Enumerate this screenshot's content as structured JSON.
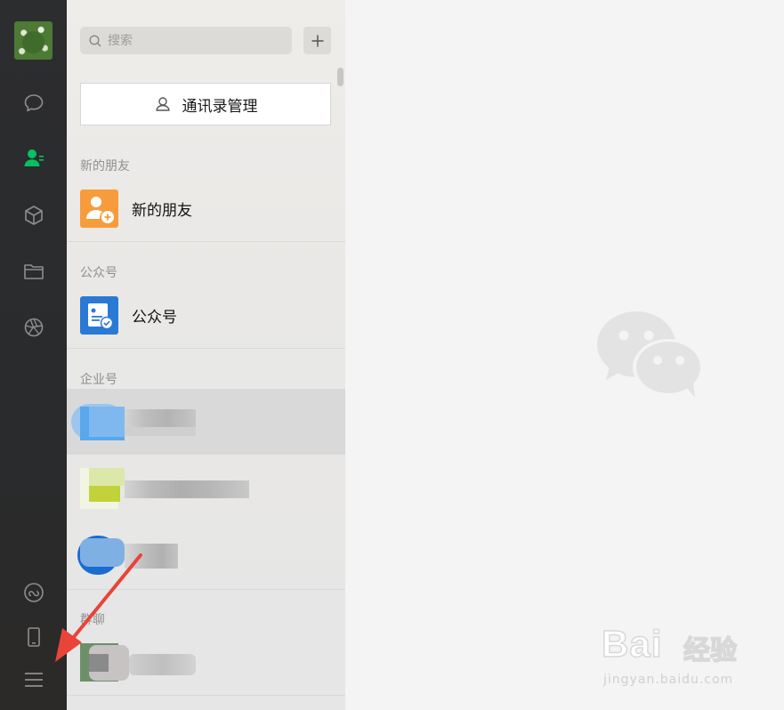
{
  "sidebar": {
    "avatar": "user-avatar",
    "icons": [
      "chat-icon",
      "contacts-icon",
      "favorites-cube-icon",
      "files-folder-icon",
      "moments-icon",
      "mini-program-icon",
      "phone-icon",
      "menu-icon"
    ],
    "active": "contacts-icon",
    "accent": "#07c160"
  },
  "search": {
    "placeholder": "搜索"
  },
  "add_button": "+",
  "manage_contacts": {
    "label": "通讯录管理"
  },
  "sections": {
    "new_friends": "新的朋友",
    "official_accounts": "公众号",
    "enterprise": "企业号",
    "group_chats": "群聊"
  },
  "rows": {
    "new_friends": "新的朋友",
    "official_accounts": "公众号"
  },
  "colors": {
    "new_friends_icon": "#f79c3c",
    "official_icon": "#2a7ad5",
    "arrow": "#e8443a"
  },
  "watermark": {
    "brand": "Bai",
    "brand2": "经验",
    "url": "jingyan.baidu.com"
  }
}
